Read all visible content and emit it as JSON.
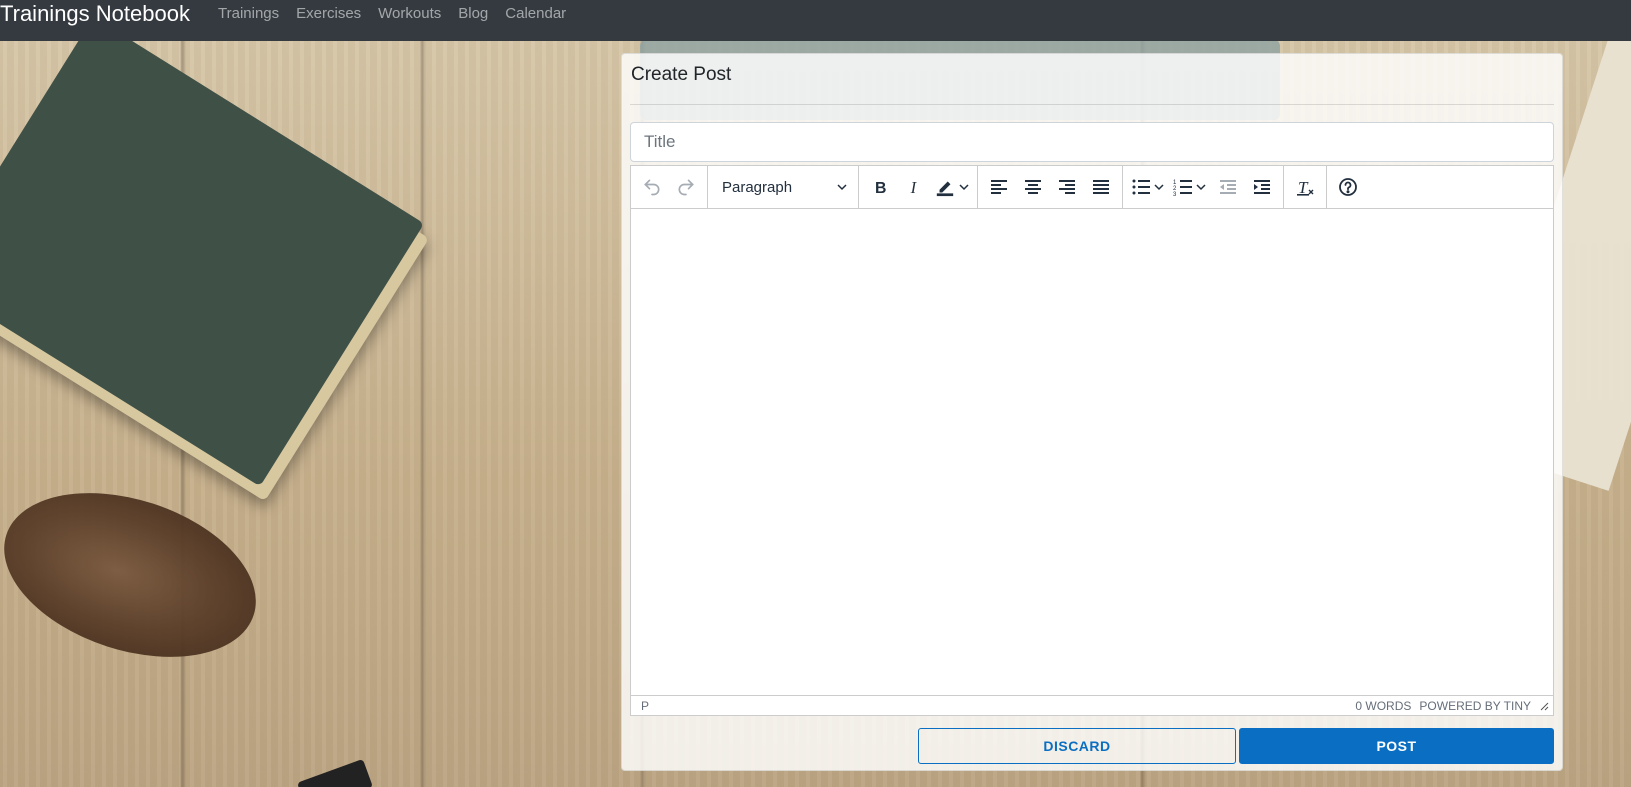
{
  "navbar": {
    "brand": "Trainings Notebook",
    "links": [
      "Trainings",
      "Exercises",
      "Workouts",
      "Blog",
      "Calendar"
    ]
  },
  "card": {
    "title": "Create Post",
    "title_input": {
      "placeholder": "Title",
      "value": ""
    }
  },
  "editor": {
    "toolbar": {
      "undo_icon": "undo-icon",
      "redo_icon": "redo-icon",
      "block_format": "Paragraph",
      "buttons": [
        "bold",
        "italic",
        "highlight-color",
        "align-left",
        "align-center",
        "align-right",
        "align-justify",
        "bullet-list",
        "numbered-list",
        "outdent",
        "indent",
        "clear-formatting",
        "help"
      ]
    },
    "status": {
      "path": "P",
      "word_count": "0 WORDS",
      "branding": "POWERED BY TINY"
    }
  },
  "actions": {
    "discard": "DISCARD",
    "post": "POST"
  },
  "colors": {
    "navbar": "#343a40",
    "primary": "#0a6fc2"
  }
}
